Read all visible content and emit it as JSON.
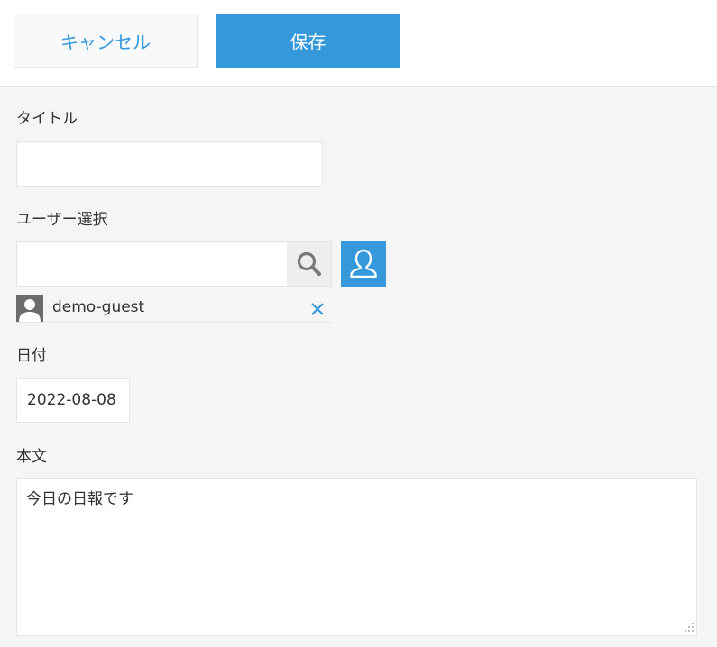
{
  "toolbar": {
    "cancel_label": "キャンセル",
    "save_label": "保存"
  },
  "form": {
    "title": {
      "label": "タイトル",
      "value": ""
    },
    "user_select": {
      "label": "ユーザー選択",
      "search_value": "",
      "search_icon": "search-icon",
      "user_icon": "user-outline-icon",
      "selected_users": [
        {
          "name": "demo-guest",
          "avatar_icon": "person-silhouette-icon",
          "remove_icon": "close-icon"
        }
      ]
    },
    "date": {
      "label": "日付",
      "value": "2022-08-08"
    },
    "body": {
      "label": "本文",
      "value": "今日の日報です"
    }
  },
  "colors": {
    "accent": "#3498db",
    "page_background": "#f5f5f5",
    "border": "#e3e7e8",
    "text": "#333333"
  }
}
